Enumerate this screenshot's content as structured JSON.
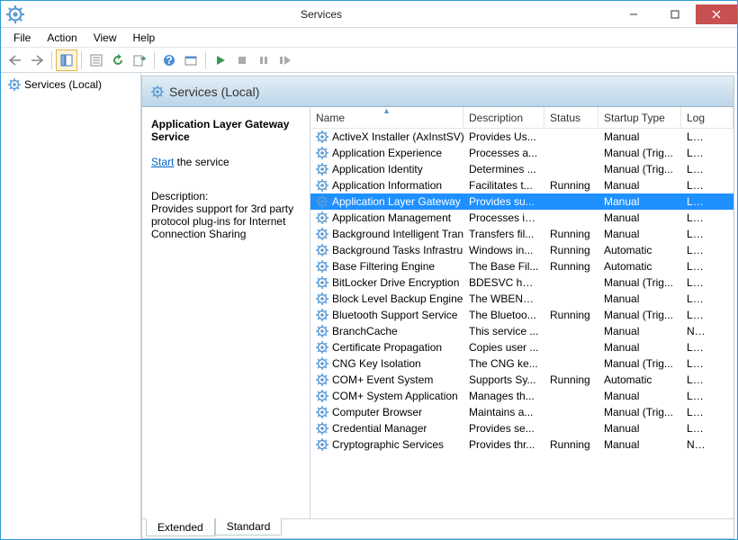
{
  "window": {
    "title": "Services"
  },
  "menu": {
    "file": "File",
    "action": "Action",
    "view": "View",
    "help": "Help"
  },
  "sidebar": {
    "label": "Services (Local)"
  },
  "content_header": {
    "title": "Services (Local)"
  },
  "detail": {
    "selected_name": "Application Layer Gateway Service",
    "start_label": "Start",
    "start_suffix": " the service",
    "desc_label": "Description:",
    "desc_text": "Provides support for 3rd party protocol plug-ins for Internet Connection Sharing"
  },
  "columns": {
    "name": "Name",
    "desc": "Description",
    "status": "Status",
    "startup": "Startup Type",
    "logon": "Log"
  },
  "tabs": {
    "extended": "Extended",
    "standard": "Standard"
  },
  "rows": [
    {
      "name": "ActiveX Installer (AxInstSV)",
      "desc": "Provides Us...",
      "status": "",
      "startup": "Manual",
      "logon": "Loc"
    },
    {
      "name": "Application Experience",
      "desc": "Processes a...",
      "status": "",
      "startup": "Manual (Trig...",
      "logon": "Loc"
    },
    {
      "name": "Application Identity",
      "desc": "Determines ...",
      "status": "",
      "startup": "Manual (Trig...",
      "logon": "Loc"
    },
    {
      "name": "Application Information",
      "desc": "Facilitates t...",
      "status": "Running",
      "startup": "Manual",
      "logon": "Loc"
    },
    {
      "name": "Application Layer Gateway ...",
      "desc": "Provides su...",
      "status": "",
      "startup": "Manual",
      "logon": "Loc",
      "selected": true
    },
    {
      "name": "Application Management",
      "desc": "Processes in...",
      "status": "",
      "startup": "Manual",
      "logon": "Loc"
    },
    {
      "name": "Background Intelligent Tran...",
      "desc": "Transfers fil...",
      "status": "Running",
      "startup": "Manual",
      "logon": "Loc"
    },
    {
      "name": "Background Tasks Infrastru...",
      "desc": "Windows in...",
      "status": "Running",
      "startup": "Automatic",
      "logon": "Loc"
    },
    {
      "name": "Base Filtering Engine",
      "desc": "The Base Fil...",
      "status": "Running",
      "startup": "Automatic",
      "logon": "Loc"
    },
    {
      "name": "BitLocker Drive Encryption ...",
      "desc": "BDESVC hos...",
      "status": "",
      "startup": "Manual (Trig...",
      "logon": "Loc"
    },
    {
      "name": "Block Level Backup Engine ...",
      "desc": "The WBENG...",
      "status": "",
      "startup": "Manual",
      "logon": "Loc"
    },
    {
      "name": "Bluetooth Support Service",
      "desc": "The Bluetoo...",
      "status": "Running",
      "startup": "Manual (Trig...",
      "logon": "Loc"
    },
    {
      "name": "BranchCache",
      "desc": "This service ...",
      "status": "",
      "startup": "Manual",
      "logon": "Net"
    },
    {
      "name": "Certificate Propagation",
      "desc": "Copies user ...",
      "status": "",
      "startup": "Manual",
      "logon": "Loc"
    },
    {
      "name": "CNG Key Isolation",
      "desc": "The CNG ke...",
      "status": "",
      "startup": "Manual (Trig...",
      "logon": "Loc"
    },
    {
      "name": "COM+ Event System",
      "desc": "Supports Sy...",
      "status": "Running",
      "startup": "Automatic",
      "logon": "Loc"
    },
    {
      "name": "COM+ System Application",
      "desc": "Manages th...",
      "status": "",
      "startup": "Manual",
      "logon": "Loc"
    },
    {
      "name": "Computer Browser",
      "desc": "Maintains a...",
      "status": "",
      "startup": "Manual (Trig...",
      "logon": "Loc"
    },
    {
      "name": "Credential Manager",
      "desc": "Provides se...",
      "status": "",
      "startup": "Manual",
      "logon": "Loc"
    },
    {
      "name": "Cryptographic Services",
      "desc": "Provides thr...",
      "status": "Running",
      "startup": "Manual",
      "logon": "Net"
    }
  ]
}
